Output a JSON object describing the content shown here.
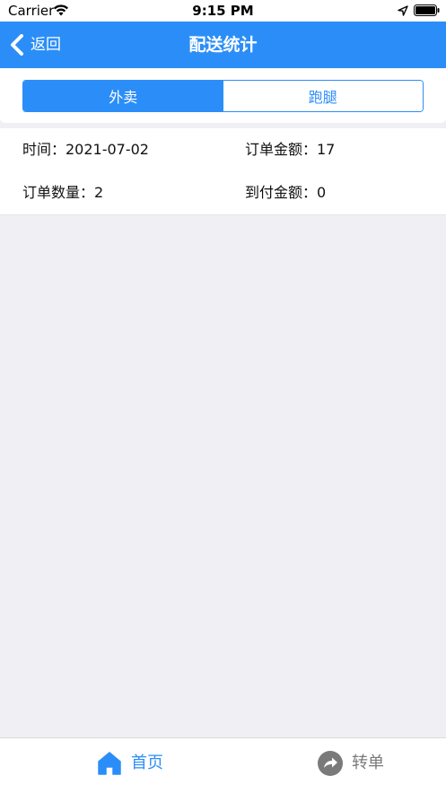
{
  "status_bar": {
    "carrier": "Carrier",
    "time": "9:15 PM",
    "icons": [
      "wifi-icon",
      "location-arrow-icon",
      "battery-icon"
    ]
  },
  "nav": {
    "back_label": "返回",
    "title": "配送统计",
    "color": "#2b8ef8"
  },
  "segments": [
    {
      "label": "外卖",
      "selected": true
    },
    {
      "label": "跑腿",
      "selected": false
    }
  ],
  "stats": {
    "date": "时间：2021-07-02",
    "order_amount": "订单金额：17",
    "order_count": "订单数量：2",
    "cod_amount": "到付金额：0"
  },
  "tab_bar": {
    "items": [
      {
        "label": "首页",
        "icon": "home-icon",
        "active": true
      },
      {
        "label": "转单",
        "icon": "share-arrow-icon",
        "active": false
      }
    ],
    "active_color": "#2b8ef8",
    "inactive_color": "#7a7a7a"
  }
}
